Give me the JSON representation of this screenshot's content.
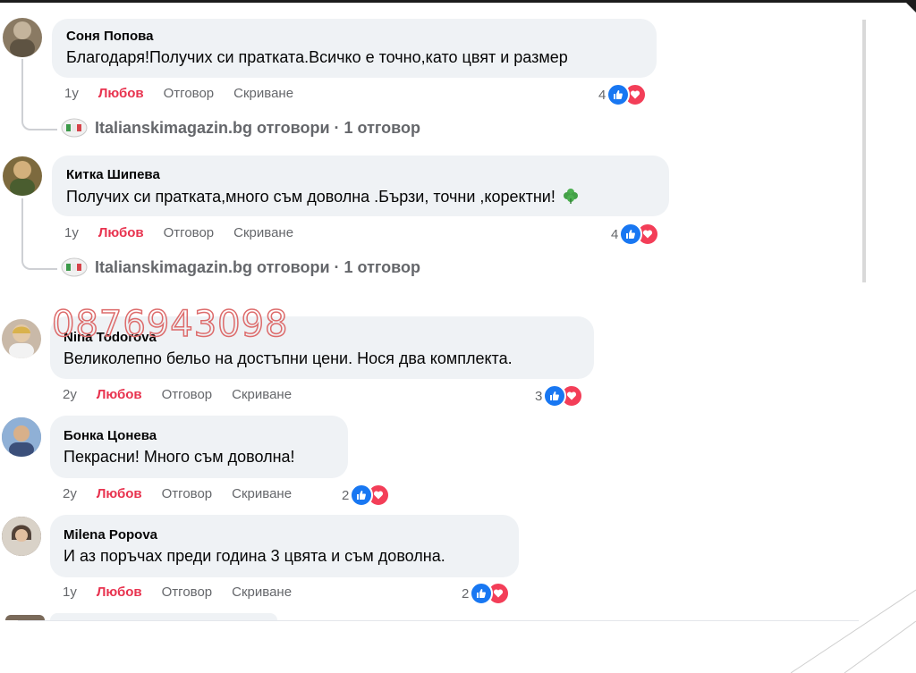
{
  "watermark": {
    "phone": "0876943098"
  },
  "comments": [
    {
      "author": "Соня Попова",
      "text": "Благодаря!Получих си пратката.Всичко е точно,като цвят и размер",
      "time": "1у",
      "love_label": "Любов",
      "reply_label": "Отговор",
      "hide_label": "Скриване",
      "reactions": "4",
      "page_reply": "Italianskimagazin.bg отговори · 1 отговор",
      "avatar_color": "#8a7a63"
    },
    {
      "author": "Китка Шипева",
      "text": "Получих си пратката,много съм доволна .Бързи, точни ,коректни!",
      "time": "1у",
      "love_label": "Любов",
      "reply_label": "Отговор",
      "hide_label": "Скриване",
      "reactions": "4",
      "page_reply": "Italianskimagazin.bg отговори · 1 отговор",
      "avatar_color": "#7d6a3e"
    },
    {
      "author": "Nina Todorova",
      "text": "Великолепно бельо на достъпни цени. Нося два комплекта.",
      "time": "2у",
      "love_label": "Любов",
      "reply_label": "Отговор",
      "hide_label": "Скриване",
      "reactions": "3",
      "avatar_color": "#c9b9a8"
    },
    {
      "author": "Бонка Цонева",
      "text": "Пекрасни! Много съм доволна!",
      "time": "2у",
      "love_label": "Любов",
      "reply_label": "Отговор",
      "hide_label": "Скриване",
      "reactions": "2",
      "avatar_color": "#6b7fa0"
    },
    {
      "author": "Milena Popova",
      "text": "И аз поръчах преди година 3 цвята и съм доволна.",
      "time": "1у",
      "love_label": "Любов",
      "reply_label": "Отговор",
      "hide_label": "Скриване",
      "reactions": "2",
      "avatar_color": "#5a4236"
    }
  ],
  "colors": {
    "like": "#1877f2",
    "love": "#e8334f",
    "bubble": "#eff2f5",
    "meta": "#65676b"
  }
}
